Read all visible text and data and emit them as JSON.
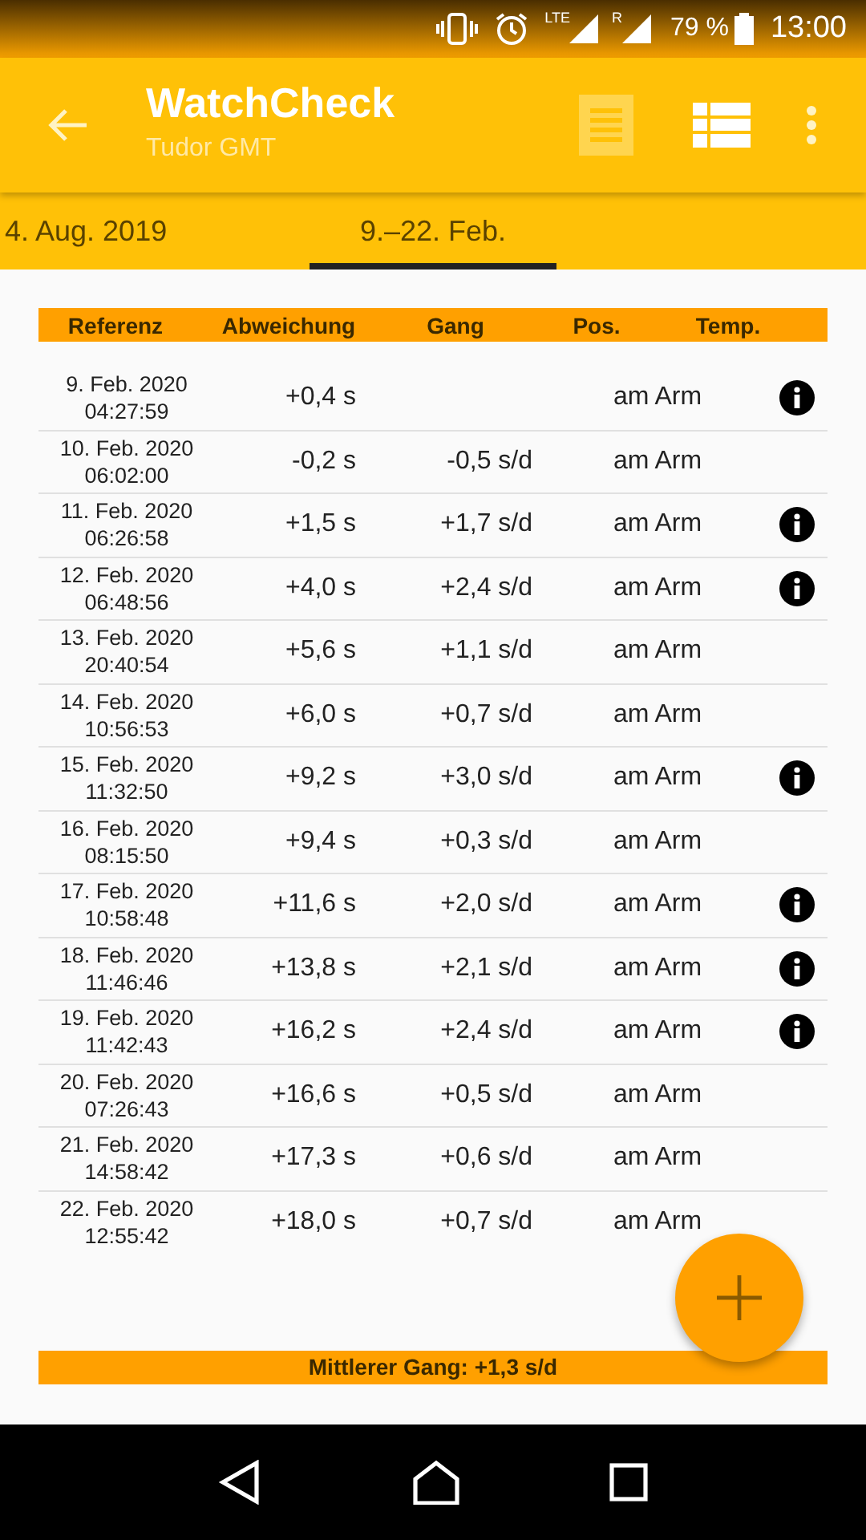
{
  "status_bar": {
    "network_1": "LTE",
    "network_2": "R",
    "battery": "79 %",
    "time": "13:00"
  },
  "app_bar": {
    "title": "WatchCheck",
    "subtitle": "Tudor GMT"
  },
  "tabs": [
    {
      "label": "4. Aug. 2019",
      "selected": false
    },
    {
      "label": "9.–22. Feb.",
      "selected": true
    }
  ],
  "table": {
    "columns": [
      "Referenz",
      "Abweichung",
      "Gang",
      "Pos.",
      "Temp."
    ],
    "rows": [
      {
        "date": "9. Feb. 2020",
        "time": "04:27:59",
        "deviation": "+0,4 s",
        "rate": "",
        "position": "am Arm",
        "info": true
      },
      {
        "date": "10. Feb. 2020",
        "time": "06:02:00",
        "deviation": "-0,2 s",
        "rate": "-0,5 s/d",
        "position": "am Arm",
        "info": false
      },
      {
        "date": "11. Feb. 2020",
        "time": "06:26:58",
        "deviation": "+1,5 s",
        "rate": "+1,7 s/d",
        "position": "am Arm",
        "info": true
      },
      {
        "date": "12. Feb. 2020",
        "time": "06:48:56",
        "deviation": "+4,0 s",
        "rate": "+2,4 s/d",
        "position": "am Arm",
        "info": true
      },
      {
        "date": "13. Feb. 2020",
        "time": "20:40:54",
        "deviation": "+5,6 s",
        "rate": "+1,1 s/d",
        "position": "am Arm",
        "info": false
      },
      {
        "date": "14. Feb. 2020",
        "time": "10:56:53",
        "deviation": "+6,0 s",
        "rate": "+0,7 s/d",
        "position": "am Arm",
        "info": false
      },
      {
        "date": "15. Feb. 2020",
        "time": "11:32:50",
        "deviation": "+9,2 s",
        "rate": "+3,0 s/d",
        "position": "am Arm",
        "info": true
      },
      {
        "date": "16. Feb. 2020",
        "time": "08:15:50",
        "deviation": "+9,4 s",
        "rate": "+0,3 s/d",
        "position": "am Arm",
        "info": false
      },
      {
        "date": "17. Feb. 2020",
        "time": "10:58:48",
        "deviation": "+11,6 s",
        "rate": "+2,0 s/d",
        "position": "am Arm",
        "info": true
      },
      {
        "date": "18. Feb. 2020",
        "time": "11:46:46",
        "deviation": "+13,8 s",
        "rate": "+2,1 s/d",
        "position": "am Arm",
        "info": true
      },
      {
        "date": "19. Feb. 2020",
        "time": "11:42:43",
        "deviation": "+16,2 s",
        "rate": "+2,4 s/d",
        "position": "am Arm",
        "info": true
      },
      {
        "date": "20. Feb. 2020",
        "time": "07:26:43",
        "deviation": "+16,6 s",
        "rate": "+0,5 s/d",
        "position": "am Arm",
        "info": false
      },
      {
        "date": "21. Feb. 2020",
        "time": "14:58:42",
        "deviation": "+17,3 s",
        "rate": "+0,6 s/d",
        "position": "am Arm",
        "info": false
      },
      {
        "date": "22. Feb. 2020",
        "time": "12:55:42",
        "deviation": "+18,0 s",
        "rate": "+0,7 s/d",
        "position": "am Arm",
        "info": false
      }
    ]
  },
  "summary": "Mittlerer Gang: +1,3 s/d"
}
